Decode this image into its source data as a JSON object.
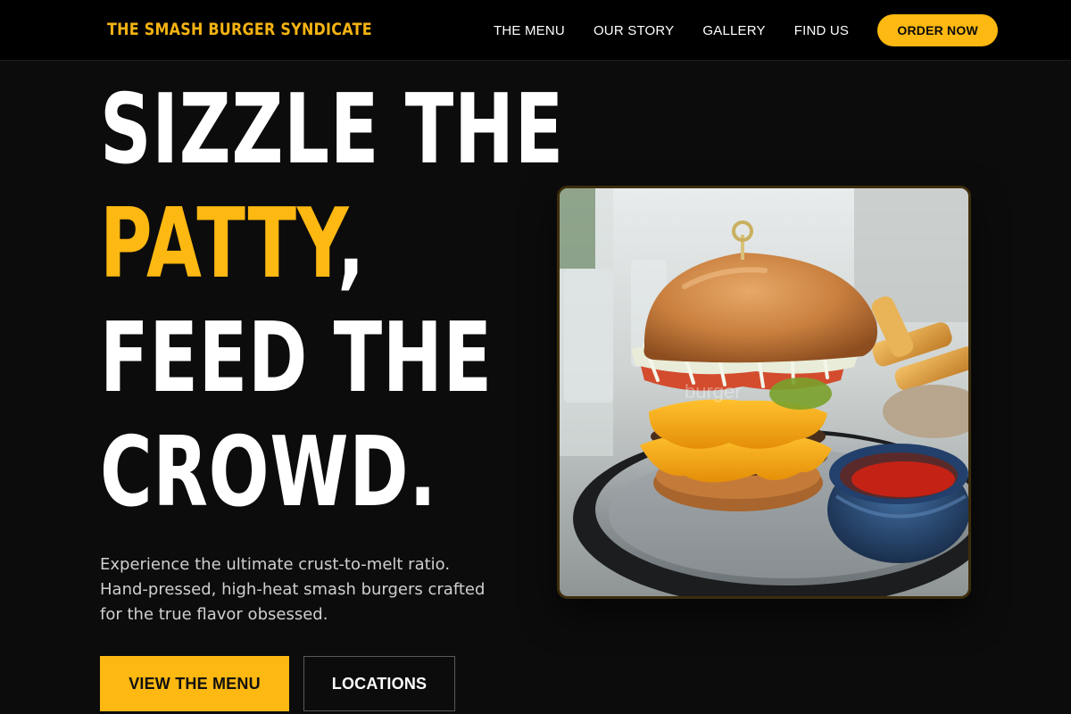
{
  "header": {
    "brand": "THE SMASH BURGER SYNDICATE",
    "nav": [
      "THE MENU",
      "OUR STORY",
      "GALLERY",
      "FIND US"
    ],
    "cta": "ORDER NOW"
  },
  "hero": {
    "title": {
      "line1": "SIZZLE THE",
      "line2_accent": "PATTY",
      "line2_rest": ",",
      "line3": "FEED THE",
      "line4": "CROWD."
    },
    "description": [
      "Experience the ultimate crust-to-melt ratio.",
      "Hand-pressed, high-heat smash burgers crafted",
      "for the true flavor obsessed."
    ],
    "primary_button": "VIEW THE MENU",
    "secondary_button": "LOCATIONS",
    "image_watermark": "burger"
  },
  "colors": {
    "accent": "#fdb811",
    "background": "#0c0c0c",
    "header_background": "#000000",
    "text": "#ffffff",
    "muted_text": "#cfcfcf"
  },
  "icons": {
    "hero_image": "smash-burger-photo"
  }
}
